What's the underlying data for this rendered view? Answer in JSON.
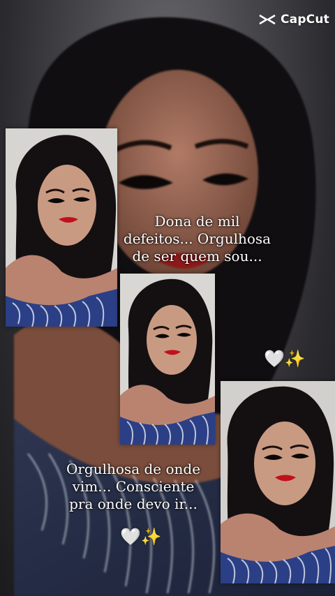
{
  "brand": {
    "name": "CapCut",
    "icon": "capcut-logo-icon"
  },
  "captions": {
    "top": [
      "Dona de mil",
      "defeitos... Orgulhosa",
      "de ser quem sou..."
    ],
    "bottom": [
      "Orgulhosa de onde",
      "vim... Consciente",
      "pra onde devo ir..."
    ]
  },
  "emojis": {
    "heart": "🤍",
    "sparkles": "✨"
  },
  "colors": {
    "text": "#ffffff",
    "lipstick": "#c0101c",
    "dress": "#2b3f86",
    "hair": "#121014"
  }
}
